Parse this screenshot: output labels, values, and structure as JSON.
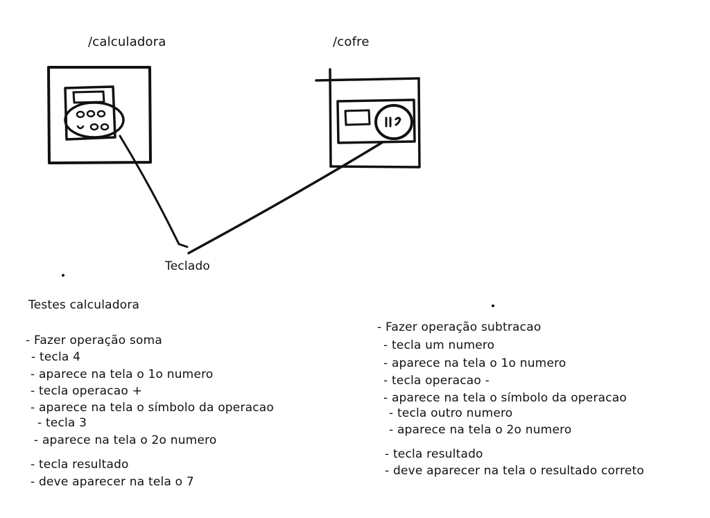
{
  "screens": {
    "calculadora": {
      "route": "/calculadora"
    },
    "cofre": {
      "route": "/cofre"
    }
  },
  "connector_label": "Teclado",
  "tests_left": {
    "heading": "Testes calculadora",
    "lines": [
      "- Fazer operação soma",
      "- tecla 4",
      "- aparece na tela o 1o numero",
      "- tecla operacao +",
      "- aparece na tela o símbolo da operacao",
      "- tecla 3",
      "- aparece na tela o 2o numero",
      "- tecla resultado",
      "- deve aparecer na tela o 7"
    ]
  },
  "tests_right": {
    "lines": [
      "- Fazer operação subtracao",
      "- tecla um numero",
      "- aparece na tela o 1o numero",
      "- tecla operacao -",
      "- aparece na tela o símbolo da operacao",
      "- tecla outro numero",
      "- aparece na tela o 2o numero",
      "- tecla resultado",
      "- deve aparecer na tela o resultado correto"
    ]
  },
  "colors": {
    "ink": "#111111",
    "background": "#ffffff"
  }
}
